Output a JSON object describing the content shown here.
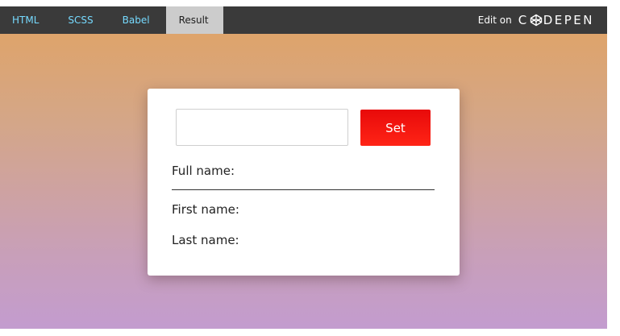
{
  "embed_bar": {
    "tabs": [
      {
        "label": "HTML"
      },
      {
        "label": "SCSS"
      },
      {
        "label": "Babel"
      },
      {
        "label": "Result",
        "active": true
      }
    ],
    "edit_on_label": "Edit on",
    "logo_text": {
      "left": "C",
      "right": "DEPEN"
    },
    "logo_icon": "codepen-cube-icon"
  },
  "card": {
    "input": {
      "value": "",
      "placeholder": ""
    },
    "set_label": "Set",
    "full_name": {
      "label": "Full name:",
      "value": ""
    },
    "first_name": {
      "label": "First name:",
      "value": ""
    },
    "last_name": {
      "label": "Last name:",
      "value": ""
    }
  },
  "colors": {
    "bar_bg": "#3a3a3a",
    "tab_link": "#76daff",
    "active_tab_bg": "#cccccc",
    "button_red": "#f01010",
    "gradient_top": "#dea46b",
    "gradient_bottom": "#c39ccf"
  }
}
